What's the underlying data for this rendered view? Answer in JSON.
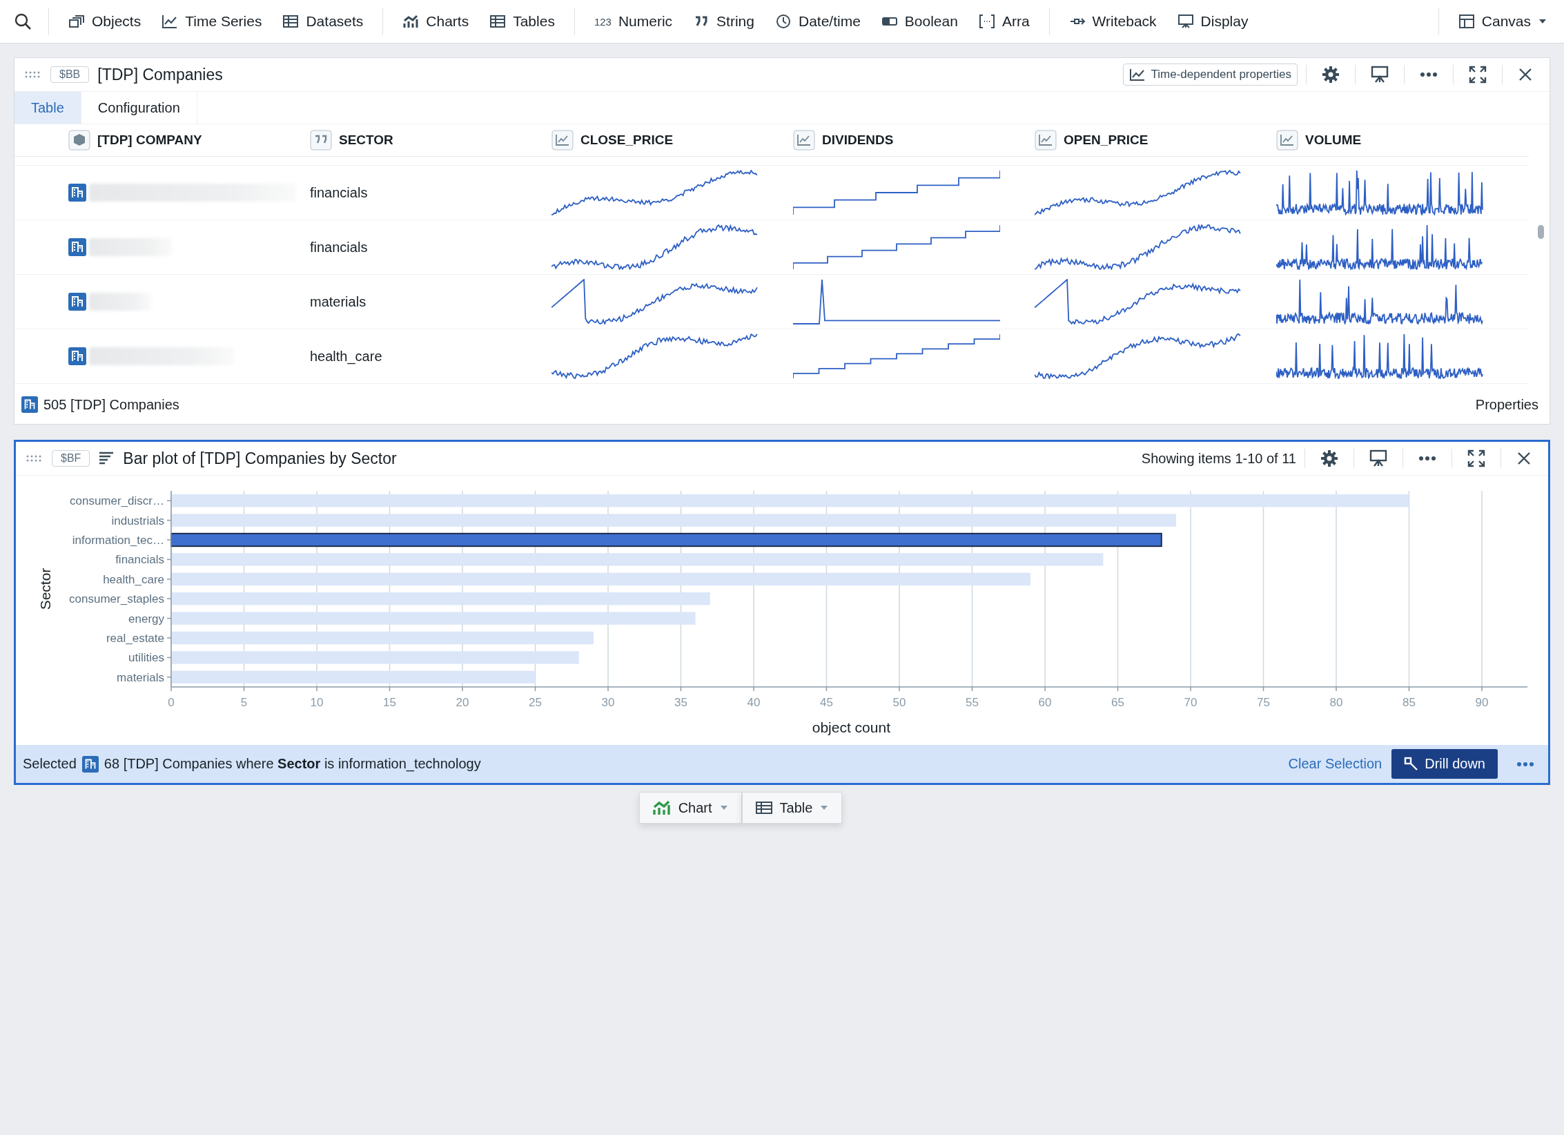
{
  "toolbar": {
    "groups": [
      [
        {
          "label": "Objects",
          "kind": "objects"
        },
        {
          "label": "Time Series",
          "kind": "timeseries"
        },
        {
          "label": "Datasets",
          "kind": "table"
        }
      ],
      [
        {
          "label": "Charts",
          "kind": "chart"
        },
        {
          "label": "Tables",
          "kind": "table"
        }
      ],
      [
        {
          "label": "Numeric",
          "kind": "digits",
          "badge": "123"
        },
        {
          "label": "String",
          "kind": "quote"
        },
        {
          "label": "Date/time",
          "kind": "clock"
        },
        {
          "label": "Boolean",
          "kind": "toggle"
        },
        {
          "label": "Arra",
          "kind": "array"
        }
      ],
      [
        {
          "label": "Writeback",
          "kind": "writeback"
        },
        {
          "label": "Display",
          "kind": "display"
        }
      ]
    ],
    "canvas": {
      "label": "Canvas"
    }
  },
  "table_panel": {
    "tag": "$BB",
    "title": "[TDP] Companies",
    "time_button": "Time-dependent properties",
    "tabs": [
      {
        "label": "Table",
        "selected": true
      },
      {
        "label": "Configuration",
        "selected": false
      }
    ],
    "columns": [
      {
        "label": "[TDP] COMPANY",
        "kind": "object"
      },
      {
        "label": "SECTOR",
        "kind": "string"
      },
      {
        "label": "CLOSE_PRICE",
        "kind": "series"
      },
      {
        "label": "DIVIDENDS",
        "kind": "series"
      },
      {
        "label": "OPEN_PRICE",
        "kind": "series"
      },
      {
        "label": "VOLUME",
        "kind": "series"
      }
    ],
    "rows": [
      {
        "sector": "financials"
      },
      {
        "sector": "financials"
      },
      {
        "sector": "materials"
      },
      {
        "sector": "health_care"
      }
    ],
    "footer": {
      "count": "505 [TDP] Companies",
      "properties": "Properties"
    }
  },
  "chart_panel": {
    "tag": "$BF",
    "title": "Bar plot of [TDP] Companies by Sector",
    "showing": "Showing items 1-10 of 11",
    "selected": true,
    "chart_data": {
      "type": "bar",
      "orientation": "horizontal",
      "xlabel": "object count",
      "ylabel": "Sector",
      "categories": [
        "consumer_discr…",
        "industrials",
        "information_tec…",
        "financials",
        "health_care",
        "consumer_staples",
        "energy",
        "real_estate",
        "utilities",
        "materials"
      ],
      "values": [
        85,
        69,
        68,
        64,
        59,
        37,
        36,
        29,
        28,
        25
      ],
      "xlim": [
        0,
        93.4
      ],
      "grid": true,
      "xticks": [
        0,
        5,
        10,
        15,
        20,
        25,
        30,
        35,
        40,
        45,
        50,
        55,
        60,
        65,
        70,
        75,
        80,
        85,
        90
      ]
    },
    "bars_selected": [
      false,
      false,
      true,
      false,
      false,
      false,
      false,
      false,
      false,
      false
    ],
    "selection": {
      "label": "Selected",
      "text": "68 [TDP] Companies where **Sector** is information_technology",
      "clear": "Clear Selection",
      "drill": "Drill down"
    }
  },
  "add_buttons": [
    {
      "label": "Chart",
      "kind": "chart"
    },
    {
      "label": "Table",
      "kind": "table"
    }
  ]
}
